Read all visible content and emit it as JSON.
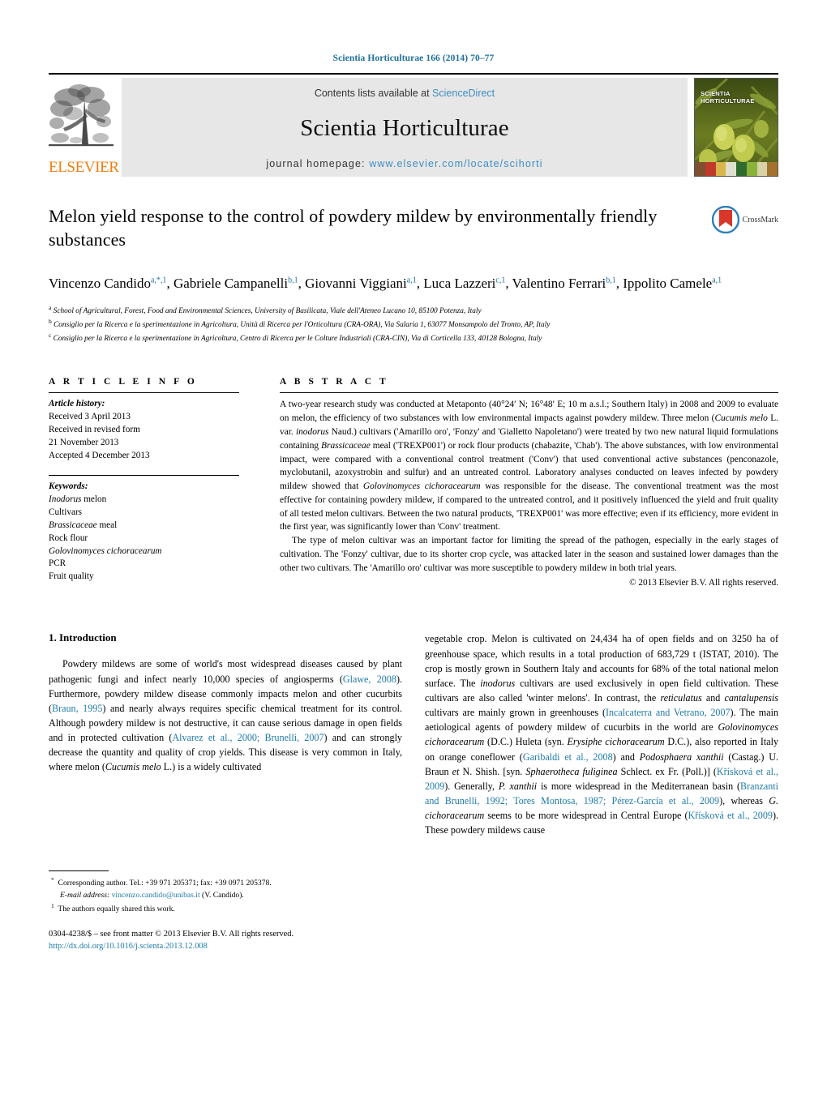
{
  "running_head": "Scientia Horticulturae 166 (2014) 70–77",
  "masthead": {
    "publisher_name": "ELSEVIER",
    "contents_prefix": "Contents lists available at ",
    "contents_link": "ScienceDirect",
    "journal_title": "Scientia Horticulturae",
    "homepage_prefix": "journal homepage: ",
    "homepage_link": "www.elsevier.com/locate/scihorti",
    "cover_title_line1": "SCIENTIA",
    "cover_title_line2": "HORTICULTURAE"
  },
  "article": {
    "title": "Melon yield response to the control of powdery mildew by environmentally friendly substances",
    "crossmark_label": "CrossMark",
    "authors_line1_pre": "Vincenzo Candido",
    "authors_html": "Vincenzo Candido<sup>a,*,1</sup>, Gabriele Campanelli<sup>b,1</sup>, Giovanni Viggiani<sup>a,1</sup>, Luca Lazzeri<sup>c,1</sup>, Valentino Ferrari<sup>b,1</sup>, Ippolito Camele<sup>a,1</sup>",
    "affiliations": [
      {
        "marker": "a",
        "text": "School of Agricultural, Forest, Food and Environmental Sciences, University of Basilicata, Viale dell'Ateneo Lucano 10, 85100 Potenza, Italy"
      },
      {
        "marker": "b",
        "text": "Consiglio per la Ricerca e la sperimentazione in Agricoltura, Unità di Ricerca per l'Orticoltura (CRA-ORA), Via Salaria 1, 63077 Monsampolo del Tronto, AP, Italy"
      },
      {
        "marker": "c",
        "text": "Consiglio per la Ricerca e la sperimentazione in Agricoltura, Centro di Ricerca per le Colture Industriali (CRA-CIN), Via di Corticella 133, 40128 Bologna, Italy"
      }
    ]
  },
  "article_info": {
    "heading": "A R T I C L E    I N F O",
    "history_label": "Article history:",
    "history": [
      "Received 3 April 2013",
      "Received in revised form",
      "21 November 2013",
      "Accepted 4 December 2013"
    ],
    "keywords_label": "Keywords:",
    "keywords": [
      "Inodorus melon",
      "Cultivars",
      "Brassicaceae meal",
      "Rock flour",
      "Golovinomyces cichoracearum",
      "PCR",
      "Fruit quality"
    ]
  },
  "abstract": {
    "heading": "A B S T R A C T",
    "paragraph1": "A two-year research study was conducted at Metaponto (40°24′ N; 16°48′ E; 10 m a.s.l.; Southern Italy) in 2008 and 2009 to evaluate on melon, the efficiency of two substances with low environmental impacts against powdery mildew. Three melon (Cucumis melo L. var. inodorus Naud.) cultivars ('Amarillo oro', 'Fonzy' and 'Gialletto Napoletano') were treated by two new natural liquid formulations containing Brassicaceae meal ('TREXP001') or rock flour products (chabazite, 'Chab'). The above substances, with low environmental impact, were compared with a conventional control treatment ('Conv') that used conventional active substances (penconazole, myclobutanil, azoxystrobin and sulfur) and an untreated control. Laboratory analyses conducted on leaves infected by powdery mildew showed that Golovinomyces cichoracearum was responsible for the disease. The conventional treatment was the most effective for containing powdery mildew, if compared to the untreated control, and it positively influenced the yield and fruit quality of all tested melon cultivars. Between the two natural products, 'TREXP001' was more effective; even if its efficiency, more evident in the first year, was significantly lower than 'Conv' treatment.",
    "paragraph2": "The type of melon cultivar was an important factor for limiting the spread of the pathogen, especially in the early stages of cultivation. The 'Fonzy' cultivar, due to its shorter crop cycle, was attacked later in the season and sustained lower damages than the other two cultivars. The 'Amarillo oro' cultivar was more susceptible to powdery mildew in both trial years.",
    "copyright": "© 2013 Elsevier B.V. All rights reserved."
  },
  "introduction": {
    "heading": "1.  Introduction",
    "left_paragraph_html": "Powdery mildews are some of world's most widespread diseases caused by plant pathogenic fungi and infect nearly 10,000 species of angiosperms (<a class=\"ref\" data-name=\"citation-link\" data-interactable=\"true\">Glawe, 2008</a>). Furthermore, powdery mildew disease commonly impacts melon and other cucurbits (<a class=\"ref\" data-name=\"citation-link\" data-interactable=\"true\">Braun, 1995</a>) and nearly always requires specific chemical treatment for its control. Although powdery mildew is not destructive, it can cause serious damage in open fields and in protected cultivation (<a class=\"ref\" data-name=\"citation-link\" data-interactable=\"true\">Alvarez et al., 2000; Brunelli, 2007</a>) and can strongly decrease the quantity and quality of crop yields. This disease is very common in Italy, where melon (<i>Cucumis melo</i> L.) is a widely cultivated",
    "right_paragraph_html": "vegetable crop. Melon is cultivated on 24,434 ha of open fields and on 3250 ha of greenhouse space, which results in a total production of 683,729 t (ISTAT, 2010). The crop is mostly grown in Southern Italy and accounts for 68% of the total national melon surface. The <i>inodorus</i> cultivars are used exclusively in open field cultivation. These cultivars are also called 'winter melons'. In contrast, the <i>reticulatus</i> and <i>cantalupensis</i> cultivars are mainly grown in greenhouses (<a class=\"ref\" data-name=\"citation-link\" data-interactable=\"true\">Incalcaterra and Vetrano, 2007</a>). The main aetiological agents of powdery mildew of cucurbits in the world are <i>Golovinomyces cichoracearum</i> (D.C.) Huleta (syn. <i>Erysiphe cichoracearum</i> D.C.), also reported in Italy on orange coneflower (<a class=\"ref\" data-name=\"citation-link\" data-interactable=\"true\">Garibaldi et al., 2008</a>) and <i>Podosphaera xanthii</i> (Castag.) U. Braun <i>et</i> N. Shish. [syn. <i>Sphaerotheca fuliginea</i> Schlect. ex Fr. (Poll.)] (<a class=\"ref\" data-name=\"citation-link\" data-interactable=\"true\">Křísková et al., 2009</a>). Generally, <i>P. xanthii</i> is more widespread in the Mediterranean basin (<a class=\"ref\" data-name=\"citation-link\" data-interactable=\"true\">Branzanti and Brunelli, 1992; Tores Montosa, 1987; Pérez-García et al., 2009</a>), whereas <i>G. cichoracearum</i> seems to be more widespread in Central Europe (<a class=\"ref\" data-name=\"citation-link\" data-interactable=\"true\">Křísková et al., 2009</a>). These powdery mildews cause"
  },
  "footnotes": {
    "corresponding_html": "<sup>*</sup>&nbsp; Corresponding author. Tel.: +39 971 205371; fax: +39 0971 205378.",
    "email_label": "E-mail address:",
    "email": "vincenzo.candido@unibas.it",
    "email_suffix": "(V. Candido).",
    "equal_html": "<sup>1</sup>&nbsp; The authors equally shared this work."
  },
  "issn_block": {
    "line1": "0304-4238/$ – see front matter © 2013 Elsevier B.V. All rights reserved.",
    "doi": "http://dx.doi.org/10.1016/j.scienta.2013.12.008"
  },
  "colors": {
    "link_blue": "#1f7aa8",
    "header_blue": "#1f6f9a",
    "elsevier_orange": "#F07F11",
    "banner_gray": "#e7e7e8"
  }
}
